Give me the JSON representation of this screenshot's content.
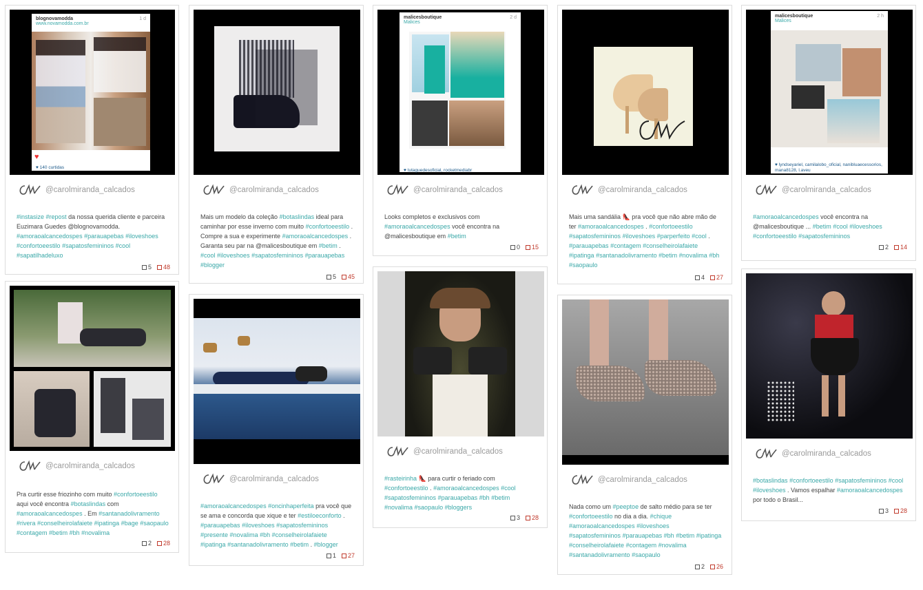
{
  "username": "@carolmiranda_calcados",
  "posts": [
    {
      "caption": [
        [
          "#instasize",
          "tag"
        ],
        [
          " ",
          ""
        ],
        [
          "#repost",
          "tag"
        ],
        [
          "  da nossa querida cliente e parceira Euzimara Guedes @blognovamodda. ",
          ""
        ],
        [
          "#amoraoalcancedospes",
          "tag"
        ],
        [
          " ",
          ""
        ],
        [
          "#parauapebas",
          "tag"
        ],
        [
          " ",
          ""
        ],
        [
          "#iloveshoes",
          "tag"
        ],
        [
          " ",
          ""
        ],
        [
          "#confortoeestilo",
          "tag"
        ],
        [
          " ",
          ""
        ],
        [
          "#sapatosfemininos",
          "tag"
        ],
        [
          " ",
          ""
        ],
        [
          "#cool",
          "tag"
        ],
        [
          " ",
          ""
        ],
        [
          "#sapatilhadeluxo",
          "tag"
        ]
      ],
      "comments": "5",
      "likes": "48",
      "ig": {
        "user": "blognovamodda",
        "sub": "www.novamodda.com.br",
        "time": "1 d",
        "foot": "♥ 140 curtidas"
      }
    },
    {
      "caption": [
        [
          "Mais um modelo da coleção ",
          ""
        ],
        [
          "#botaslindas",
          "tag"
        ],
        [
          "  ideal para caminhar por esse inverno com muito ",
          ""
        ],
        [
          "#confortoeestilo",
          "tag"
        ],
        [
          " . Compre a sua e experimente ",
          ""
        ],
        [
          "#amoraoalcancedospes",
          "tag"
        ],
        [
          " . Garanta seu par na @malicesboutique em ",
          ""
        ],
        [
          "#betim",
          "tag"
        ],
        [
          " . ",
          ""
        ],
        [
          "#cool",
          "tag"
        ],
        [
          " ",
          ""
        ],
        [
          "#iloveshoes",
          "tag"
        ],
        [
          " ",
          ""
        ],
        [
          "#sapatosfemininos",
          "tag"
        ],
        [
          " ",
          ""
        ],
        [
          "#parauapebas",
          "tag"
        ],
        [
          " ",
          ""
        ],
        [
          "#blogger",
          "tag"
        ]
      ],
      "comments": "5",
      "likes": "45"
    },
    {
      "caption": [
        [
          "Looks completos e exclusivos com ",
          ""
        ],
        [
          "#amoraoalcancedospes",
          "tag"
        ],
        [
          " você encontra na @malicesboutique em ",
          ""
        ],
        [
          "#betim",
          "tag"
        ]
      ],
      "comments": "0",
      "likes": "15",
      "ig": {
        "user": "malicesboutique",
        "sub": "Malices",
        "time": "2 d",
        "foot": "♥ tutaguedesoficial, rocketmediabr"
      }
    },
    {
      "caption": [
        [
          "Mais uma sandália 👠 pra você que não abre mão de ter ",
          ""
        ],
        [
          "#amoraoalcancedospes",
          "tag"
        ],
        [
          " . ",
          ""
        ],
        [
          "#confortoeestilo",
          "tag"
        ],
        [
          " ",
          ""
        ],
        [
          "#sapatosfemininos",
          "tag"
        ],
        [
          " ",
          ""
        ],
        [
          "#iloveshoes",
          "tag"
        ],
        [
          " ",
          ""
        ],
        [
          "#parperfeito",
          "tag"
        ],
        [
          " ",
          ""
        ],
        [
          "#cool",
          "tag"
        ],
        [
          " . ",
          ""
        ],
        [
          "#parauapebas",
          "tag"
        ],
        [
          " ",
          ""
        ],
        [
          "#contagem",
          "tag"
        ],
        [
          " ",
          ""
        ],
        [
          "#conselheirolafaiete",
          "tag"
        ],
        [
          " ",
          ""
        ],
        [
          "#ipatinga",
          "tag"
        ],
        [
          " ",
          ""
        ],
        [
          "#santanadolivramento",
          "tag"
        ],
        [
          " ",
          ""
        ],
        [
          "#betim",
          "tag"
        ],
        [
          " ",
          ""
        ],
        [
          "#novalima",
          "tag"
        ],
        [
          " ",
          ""
        ],
        [
          "#bh",
          "tag"
        ],
        [
          " ",
          ""
        ],
        [
          "#saopaulo",
          "tag"
        ]
      ],
      "comments": "4",
      "likes": "27"
    },
    {
      "caption": [
        [
          "#amoraoalcancedospes",
          "tag"
        ],
        [
          "  você encontra na @malicesboutique ... ",
          ""
        ],
        [
          "#betim",
          "tag"
        ],
        [
          " ",
          ""
        ],
        [
          "#cool",
          "tag"
        ],
        [
          " ",
          ""
        ],
        [
          "#iloveshoes",
          "tag"
        ],
        [
          " ",
          ""
        ],
        [
          "#confortoeestilo",
          "tag"
        ],
        [
          " ",
          ""
        ],
        [
          "#sapatosfemininos",
          "tag"
        ]
      ],
      "comments": "2",
      "likes": "14",
      "ig": {
        "user": "malicesboutique",
        "sub": "Malices",
        "time": "2 h",
        "foot": "♥ lyndseyariel, camilalobo_oficial, nanibluaecessorios, mana8128, l.aveu"
      }
    },
    {
      "caption": [
        [
          "Pra curtir esse friozinho com muito ",
          ""
        ],
        [
          "#confortoeestilo",
          "tag"
        ],
        [
          " aqui você encontra ",
          ""
        ],
        [
          "#botaslindas",
          "tag"
        ],
        [
          "  com ",
          ""
        ],
        [
          "#amoraoalcancedospes",
          "tag"
        ],
        [
          " . Em ",
          ""
        ],
        [
          "#santanadolivramento",
          "tag"
        ],
        [
          " ",
          ""
        ],
        [
          "#rivera",
          "tag"
        ],
        [
          " ",
          ""
        ],
        [
          "#conselheirolafaiete",
          "tag"
        ],
        [
          " ",
          ""
        ],
        [
          "#ipatinga",
          "tag"
        ],
        [
          " ",
          ""
        ],
        [
          "#bage",
          "tag"
        ],
        [
          " ",
          ""
        ],
        [
          "#saopaulo",
          "tag"
        ],
        [
          " ",
          ""
        ],
        [
          "#contagem",
          "tag"
        ],
        [
          " ",
          ""
        ],
        [
          "#betim",
          "tag"
        ],
        [
          " ",
          ""
        ],
        [
          "#bh",
          "tag"
        ],
        [
          " ",
          ""
        ],
        [
          "#novalima",
          "tag"
        ]
      ],
      "comments": "2",
      "likes": "28"
    },
    {
      "caption": [
        [
          "#amoraoalcancedospes",
          "tag"
        ],
        [
          " ",
          ""
        ],
        [
          "#oncinhaperfeita",
          "tag"
        ],
        [
          "  pra você que se ama e concorda que xique e ter ",
          ""
        ],
        [
          "#estiloeconforto",
          "tag"
        ],
        [
          " . ",
          ""
        ],
        [
          "#parauapebas",
          "tag"
        ],
        [
          " ",
          ""
        ],
        [
          "#iloveshoes",
          "tag"
        ],
        [
          " ",
          ""
        ],
        [
          "#sapatosfemininos",
          "tag"
        ],
        [
          " ",
          ""
        ],
        [
          "#presente",
          "tag"
        ],
        [
          " ",
          ""
        ],
        [
          "#novalima",
          "tag"
        ],
        [
          " ",
          ""
        ],
        [
          "#bh",
          "tag"
        ],
        [
          " ",
          ""
        ],
        [
          "#conselheirolafaiete",
          "tag"
        ],
        [
          " ",
          ""
        ],
        [
          "#ipatinga",
          "tag"
        ],
        [
          " ",
          ""
        ],
        [
          "#santanadolivramento",
          "tag"
        ],
        [
          " ",
          ""
        ],
        [
          "#betim",
          "tag"
        ],
        [
          " . ",
          ""
        ],
        [
          "#blogger",
          "tag"
        ]
      ],
      "comments": "1",
      "likes": "27"
    },
    {
      "caption": [
        [
          "#rasteirinha",
          "tag"
        ],
        [
          " 👠 para curtir o feriado com ",
          ""
        ],
        [
          "#confortoeestilo",
          "tag"
        ],
        [
          " . ",
          ""
        ],
        [
          "#amoraoalcancedospes",
          "tag"
        ],
        [
          " ",
          ""
        ],
        [
          "#cool",
          "tag"
        ],
        [
          " ",
          ""
        ],
        [
          "#sapatosfemininos",
          "tag"
        ],
        [
          " ",
          ""
        ],
        [
          "#parauapebas",
          "tag"
        ],
        [
          " ",
          ""
        ],
        [
          "#bh",
          "tag"
        ],
        [
          " ",
          ""
        ],
        [
          "#betim",
          "tag"
        ],
        [
          " ",
          ""
        ],
        [
          "#novalima",
          "tag"
        ],
        [
          " ",
          ""
        ],
        [
          "#saopaulo",
          "tag"
        ],
        [
          " ",
          ""
        ],
        [
          "#bloggers",
          "tag"
        ]
      ],
      "comments": "3",
      "likes": "28"
    },
    {
      "caption": [
        [
          "Nada como um ",
          ""
        ],
        [
          "#peeptoe",
          "tag"
        ],
        [
          "  de salto médio para se ter ",
          ""
        ],
        [
          "#confortoeestilo",
          "tag"
        ],
        [
          "  no dia a dia. ",
          ""
        ],
        [
          "#chique",
          "tag"
        ],
        [
          " ",
          ""
        ],
        [
          "#amoraoalcancedospes",
          "tag"
        ],
        [
          " ",
          ""
        ],
        [
          "#iloveshoes",
          "tag"
        ],
        [
          " ",
          ""
        ],
        [
          "#sapatosfemininos",
          "tag"
        ],
        [
          " ",
          ""
        ],
        [
          "#parauapebas",
          "tag"
        ],
        [
          " ",
          ""
        ],
        [
          "#bh",
          "tag"
        ],
        [
          " ",
          ""
        ],
        [
          "#betim",
          "tag"
        ],
        [
          " ",
          ""
        ],
        [
          "#ipatinga",
          "tag"
        ],
        [
          " ",
          ""
        ],
        [
          "#conselheirolafaiete",
          "tag"
        ],
        [
          " ",
          ""
        ],
        [
          "#contagem",
          "tag"
        ],
        [
          " ",
          ""
        ],
        [
          "#novalima",
          "tag"
        ],
        [
          " ",
          ""
        ],
        [
          "#santanadolivramento",
          "tag"
        ],
        [
          " ",
          ""
        ],
        [
          "#saopaulo",
          "tag"
        ]
      ],
      "comments": "2",
      "likes": "26"
    },
    {
      "caption": [
        [
          "#botaslindas",
          "tag"
        ],
        [
          " ",
          ""
        ],
        [
          "#confortoeestilo",
          "tag"
        ],
        [
          " ",
          ""
        ],
        [
          "#sapatosfemininos",
          "tag"
        ],
        [
          " ",
          ""
        ],
        [
          "#cool",
          "tag"
        ],
        [
          " ",
          ""
        ],
        [
          "#iloveshoes",
          "tag"
        ],
        [
          " . Vamos espalhar ",
          ""
        ],
        [
          "#amoraoalcancedospes",
          "tag"
        ],
        [
          "  por todo o Brasil...",
          ""
        ]
      ],
      "comments": "3",
      "likes": "28"
    }
  ]
}
